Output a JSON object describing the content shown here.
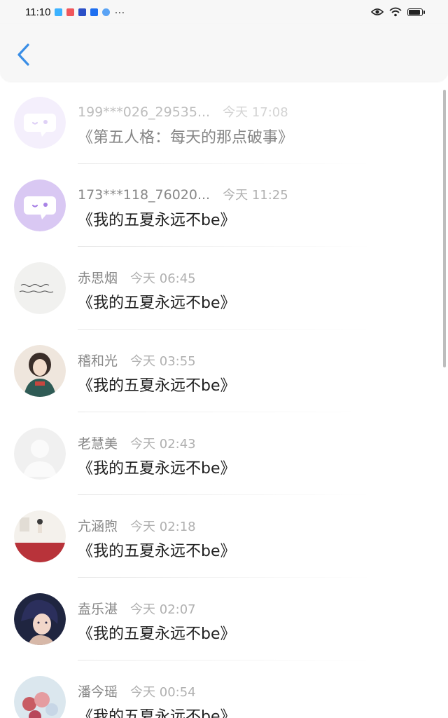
{
  "status": {
    "time": "11:10",
    "more": "···"
  },
  "colors": {
    "accent": "#3a8ee6",
    "bubble_avatar_bg": "#d9c8f3",
    "bubble_avatar_fg": "#b18ae8"
  },
  "conversations": [
    {
      "name": "199***026_29535...",
      "time": "今天 17:08",
      "message": "《第五人格：每天的那点破事》",
      "avatar": "chat-bubble-icon"
    },
    {
      "name": "173***118_76020...",
      "time": "今天 11:25",
      "message": "《我的五夏永远不be》",
      "avatar": "chat-bubble-icon"
    },
    {
      "name": "赤思烟",
      "time": "今天 06:45",
      "message": "《我的五夏永远不be》",
      "avatar": "handwriting-avatar"
    },
    {
      "name": "稽和光",
      "time": "今天 03:55",
      "message": "《我的五夏永远不be》",
      "avatar": "girl-portrait-avatar"
    },
    {
      "name": "老慧美",
      "time": "今天 02:43",
      "message": "《我的五夏永远不be》",
      "avatar": "default-person-avatar"
    },
    {
      "name": "亢涵煦",
      "time": "今天 02:18",
      "message": "《我的五夏永远不be》",
      "avatar": "room-photo-avatar"
    },
    {
      "name": "盍乐湛",
      "time": "今天 02:07",
      "message": "《我的五夏永远不be》",
      "avatar": "anime-boy-avatar"
    },
    {
      "name": "潘今瑶",
      "time": "今天 00:54",
      "message": "《我的五夏永远不be》",
      "avatar": "balloons-avatar"
    }
  ]
}
